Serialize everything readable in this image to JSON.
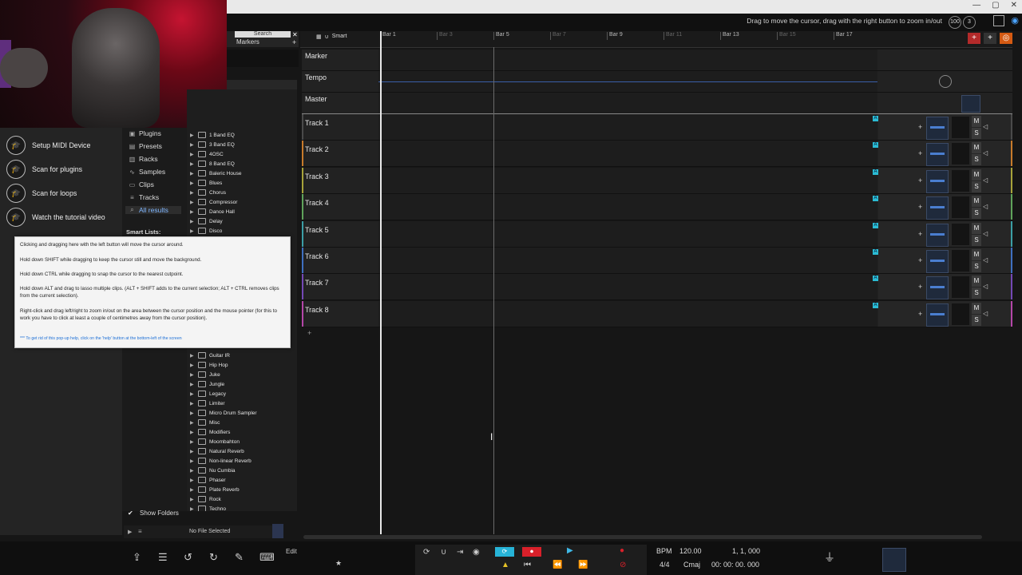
{
  "window": {
    "hint": "Drag to move the cursor, drag with the right button to zoom in/out",
    "zoom_badge": "100",
    "count_badge": "3"
  },
  "browser": {
    "search_placeholder": "Search",
    "markers_tab": "Markers",
    "welcome_items": [
      "Setup MIDI Device",
      "Scan for plugins",
      "Scan for loops",
      "Watch the tutorial video"
    ],
    "categories": [
      "Plugins",
      "Presets",
      "Racks",
      "Samples",
      "Clips",
      "Tracks",
      "All results"
    ],
    "selected_category": "All results",
    "smart_lists": "Smart Lists:",
    "folders_top": [
      "1 Band EQ",
      "3 Band EQ",
      "4OSC",
      "8 Band EQ",
      "Baleric House",
      "Blues",
      "Chorus",
      "Compressor",
      "Dance Hall",
      "Delay",
      "Disco"
    ],
    "folders_bottom": [
      "Guitar IR",
      "Hip Hop",
      "Juke",
      "Jungle",
      "Legacy",
      "Limiter",
      "Micro Drum Sampler",
      "Misc",
      "Modifiers",
      "Moombahton",
      "Natural Reverb",
      "Non-linear Reverb",
      "Nu Cumbia",
      "Phaser",
      "Plate Reverb",
      "Rock",
      "Techno"
    ],
    "show_folders": "Show Folders",
    "no_file": "No File Selected"
  },
  "help_popup": {
    "line1": "Clicking and dragging here with the left button will move the cursor around.",
    "line2": "Hold down SHIFT while dragging to keep the cursor still and move the background.",
    "line3": "Hold down CTRL while dragging to snap the cursor to the nearest cutpoint.",
    "line4": "Hold down ALT and drag to lasso multiple clips. (ALT + SHIFT adds to the current selection; ALT + CTRL removes clips from the current selection).",
    "line5": "Right-click and drag left/right to zoom in/out on the area between the cursor position and the mouse pointer (for this to work you have to click at least a couple of centimetres away from the cursor position).",
    "footer": "*** To get rid of this pop-up help, click on the 'help' button at the bottom-left of the screen"
  },
  "timeline": {
    "smart_label": "Smart",
    "bars_major": [
      "Bar 1",
      "Bar 5",
      "Bar 9",
      "Bar 13",
      "Bar 17"
    ],
    "bars_minor": [
      "Bar 3",
      "Bar 7",
      "Bar 11",
      "Bar 15"
    ],
    "global_tracks": [
      "Marker",
      "Tempo",
      "Master"
    ],
    "tracks": [
      {
        "name": "Track 1",
        "color": "#4a4a4a"
      },
      {
        "name": "Track 2",
        "color": "#c77a2b"
      },
      {
        "name": "Track 3",
        "color": "#a7a33a"
      },
      {
        "name": "Track 4",
        "color": "#5fa35a"
      },
      {
        "name": "Track 5",
        "color": "#3b9ea5"
      },
      {
        "name": "Track 6",
        "color": "#3f6fc0"
      },
      {
        "name": "Track 7",
        "color": "#7448b5"
      },
      {
        "name": "Track 8",
        "color": "#b446a8"
      }
    ],
    "mute_label": "M",
    "solo_label": "S"
  },
  "transport": {
    "edit_label": "Edit",
    "bpm_label": "BPM",
    "bpm_value": "120.00",
    "position": "1, 1, 000",
    "time_signature": "4/4",
    "key": "Cmaj",
    "time": "00: 00: 00. 000"
  },
  "colors": {
    "accent": "#2bbcd4",
    "record": "#d9202a",
    "playhead": "#e8e8e8"
  }
}
